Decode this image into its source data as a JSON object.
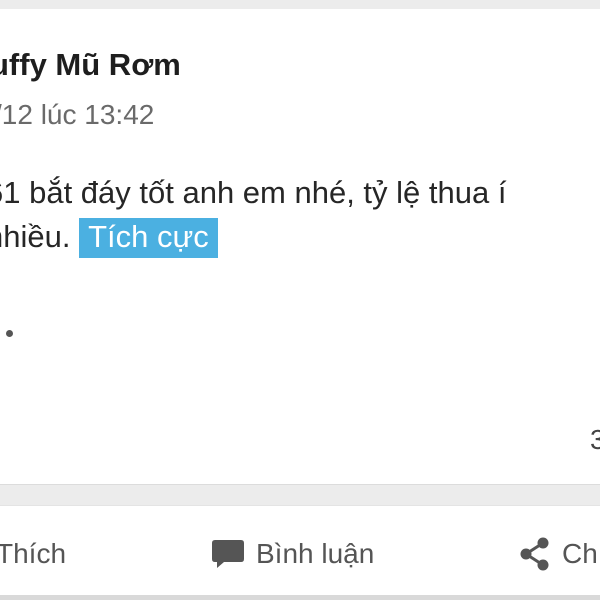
{
  "post": {
    "author_name": "uffy Mũ Rơm",
    "timestamp": "/12 lúc 13:42",
    "text_line1": "61 bắt đáy tốt anh em nhé, tỷ lệ thua í",
    "text_line2_prefix": "nhiều. ",
    "sentiment_tag": "Tích cực",
    "reaction_count": "3"
  },
  "actions": {
    "like_label": "Thích",
    "comment_label": "Bình luận",
    "share_label": "Ch"
  },
  "colors": {
    "tag_background": "#4bb0e1",
    "icon_gray": "#555555"
  },
  "icons": {
    "comment": "speech-bubble-icon",
    "share": "share-icon"
  }
}
